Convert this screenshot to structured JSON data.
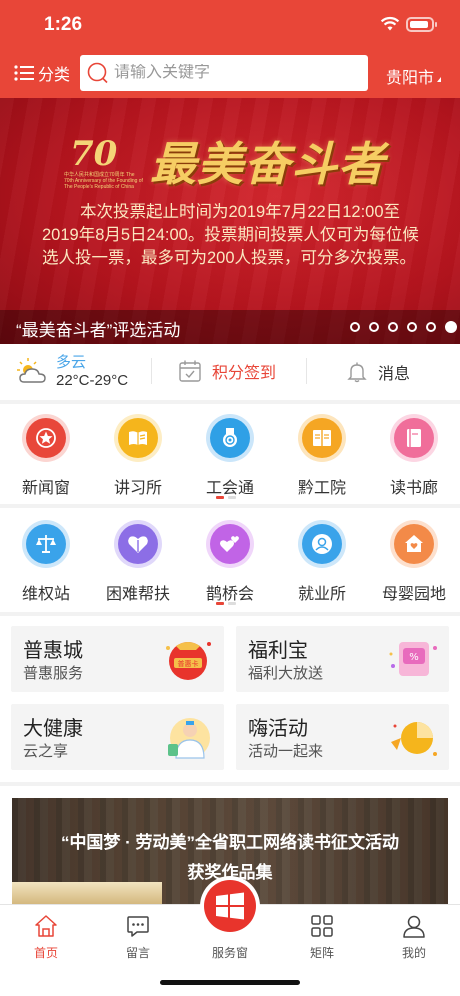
{
  "status_bar": {
    "time": "1:26",
    "battery_level": 0.9
  },
  "header": {
    "category_label": "分类",
    "search_placeholder": "请输入关键字",
    "city": "贵阳市"
  },
  "banner": {
    "emblem_text": "70",
    "emblem_caption": "中华人民共和国成立70周年 The 70th Anniversary of the Founding of The People's Republic of China",
    "title": "最美奋斗者",
    "body": "本次投票起止时间为2019年7月22日12:00至2019年8月5日24:00。投票期间投票人仅可为每位候选人投一票，最多可为200人投票，可分多次投票。",
    "caption": "“最美奋斗者”评选活动",
    "slide_count": 6,
    "active_slide": 6
  },
  "info_row": {
    "weather_condition": "多云",
    "weather_temp": "22°C-29°C",
    "signin_label": "积分签到",
    "message_label": "消息"
  },
  "grid1": [
    {
      "label": "新闻窗",
      "icon": "star-medal-icon",
      "color": "#e8473a"
    },
    {
      "label": "讲习所",
      "icon": "open-book-icon",
      "color": "#f5b51c"
    },
    {
      "label": "工会通",
      "icon": "badge-icon",
      "color": "#2fa0e6"
    },
    {
      "label": "黔工院",
      "icon": "reading-book-icon",
      "color": "#f5a623"
    },
    {
      "label": "读书廊",
      "icon": "book-icon",
      "color": "#f06e9a"
    }
  ],
  "grid2": [
    {
      "label": "维权站",
      "icon": "scales-icon",
      "color": "#3aa3ea"
    },
    {
      "label": "困难帮扶",
      "icon": "helping-hands-icon",
      "color": "#8c6ee6"
    },
    {
      "label": "鹊桥会",
      "icon": "hearts-icon",
      "color": "#c164e6"
    },
    {
      "label": "就业所",
      "icon": "person-search-icon",
      "color": "#3aa3ea"
    },
    {
      "label": "母婴园地",
      "icon": "house-heart-icon",
      "color": "#f38a48"
    }
  ],
  "cards": [
    {
      "title": "普惠城",
      "subtitle": "普惠服务",
      "art": "lucky-bag-icon",
      "art_text": "普惠卡"
    },
    {
      "title": "福利宝",
      "subtitle": "福利大放送",
      "art": "discount-coupon-icon",
      "art_text": "%"
    },
    {
      "title": "大健康",
      "subtitle": "云之享",
      "art": "doctor-icon",
      "art_text": ""
    },
    {
      "title": "嗨活动",
      "subtitle": "活动一起来",
      "art": "party-icon",
      "art_text": ""
    }
  ],
  "promo": {
    "line1": "“中国梦 · 劳动美”全省职工网络读书征文活动",
    "line2": "获奖作品集"
  },
  "tabbar": [
    {
      "label": "首页",
      "icon": "home-icon",
      "active": true
    },
    {
      "label": "留言",
      "icon": "comment-icon",
      "active": false
    },
    {
      "label": "服务窗",
      "icon": "windows-icon",
      "active": false
    },
    {
      "label": "矩阵",
      "icon": "matrix-icon",
      "active": false
    },
    {
      "label": "我的",
      "icon": "user-icon",
      "active": false
    }
  ],
  "colors": {
    "brand_red": "#e84638",
    "weather_blue": "#4aa5e8"
  }
}
